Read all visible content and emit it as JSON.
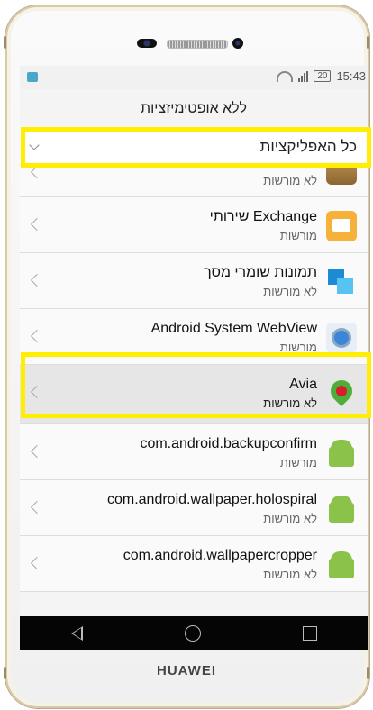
{
  "status_bar": {
    "battery": "20",
    "time": "15:43"
  },
  "header": {
    "title": "ללא אופטימיזציות"
  },
  "filter": {
    "label": "כל האפליקציות"
  },
  "apps": [
    {
      "name": "",
      "status": "לא מורשות",
      "icon": "wallet-icon"
    },
    {
      "name": "שירותי Exchange",
      "status": "מורשות",
      "icon": "exchange-mail-icon"
    },
    {
      "name": "תמונות שומרי מסך",
      "status": "לא מורשות",
      "icon": "screensaver-icon"
    },
    {
      "name": "Android System WebView",
      "status": "מורשות",
      "icon": "webview-gear-icon"
    },
    {
      "name": "Avia",
      "status": "לא מורשות",
      "icon": "avia-icon"
    },
    {
      "name": "com.android.backupconfirm",
      "status": "מורשות",
      "icon": "android-icon"
    },
    {
      "name": "com.android.wallpaper.holospiral",
      "status": "לא מורשות",
      "icon": "android-icon"
    },
    {
      "name": "com.android.wallpapercropper",
      "status": "לא מורשות",
      "icon": "android-icon"
    }
  ],
  "brand": "HUAWEI",
  "highlight_color": "#ffee00"
}
